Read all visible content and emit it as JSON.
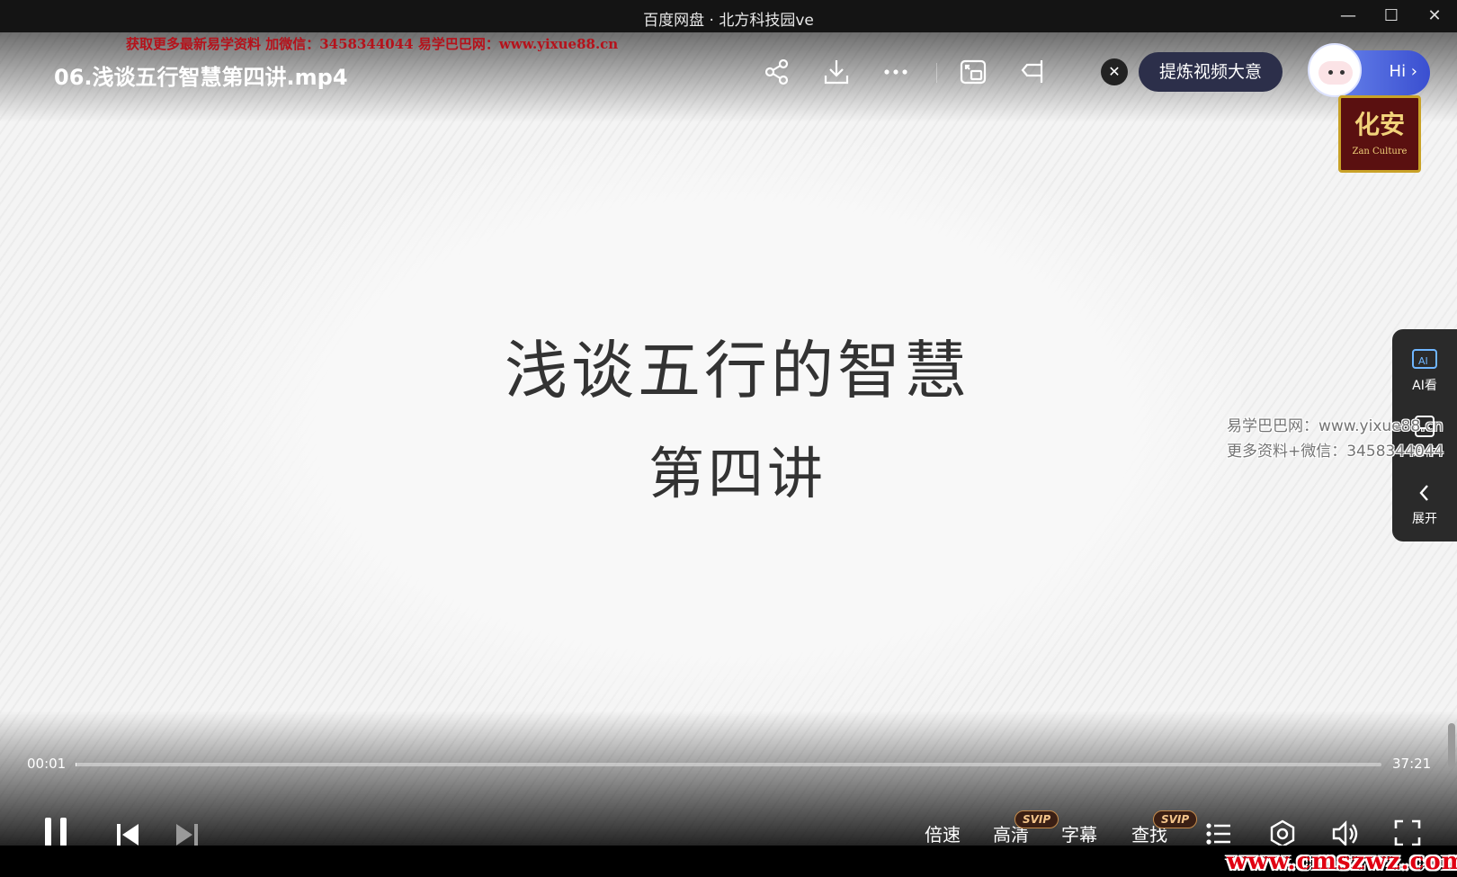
{
  "window": {
    "title": "百度网盘 · 北方科技园ve",
    "minimize_label": "—",
    "maximize_label": "☐",
    "close_label": "✕"
  },
  "player": {
    "file_title": "06.浅谈五行智慧第四讲.mp4",
    "top_watermark": "获取更多最新易学资料 加微信：3458344044 易学巴巴网：www.yixue88.cn",
    "summary_close_label": "✕",
    "summary_button": "提炼视频大意",
    "assistant_greeting": "Hi ›"
  },
  "video": {
    "logo_text": "化安",
    "logo_subtext": "Zan Culture",
    "slide_title": "浅谈五行的智慧",
    "slide_subtitle": "第四讲",
    "watermark_line1": "易学巴巴网：www.yixue88.cn",
    "watermark_line2": "更多资料+微信：3458344044"
  },
  "side_panel": {
    "items": [
      {
        "label": "AI看",
        "icon": "ai-watch-icon"
      },
      {
        "label": "课件",
        "icon": "courseware-icon"
      },
      {
        "label": "展开",
        "icon": "chevron-left-icon"
      }
    ]
  },
  "controls": {
    "current_time": "00:01",
    "duration": "37:21",
    "progress_fraction": 0.0004,
    "speed_label": "倍速",
    "quality_label": "高清",
    "quality_badge": "SVIP",
    "subtitle_label": "字幕",
    "search_label": "查找",
    "search_badge": "SVIP"
  },
  "footer_watermark": "www.cmszwz.com",
  "colors": {
    "accent_blue": "#4a63e0",
    "watermark_red": "#e00012",
    "svip_gold": "#f3c48a"
  }
}
